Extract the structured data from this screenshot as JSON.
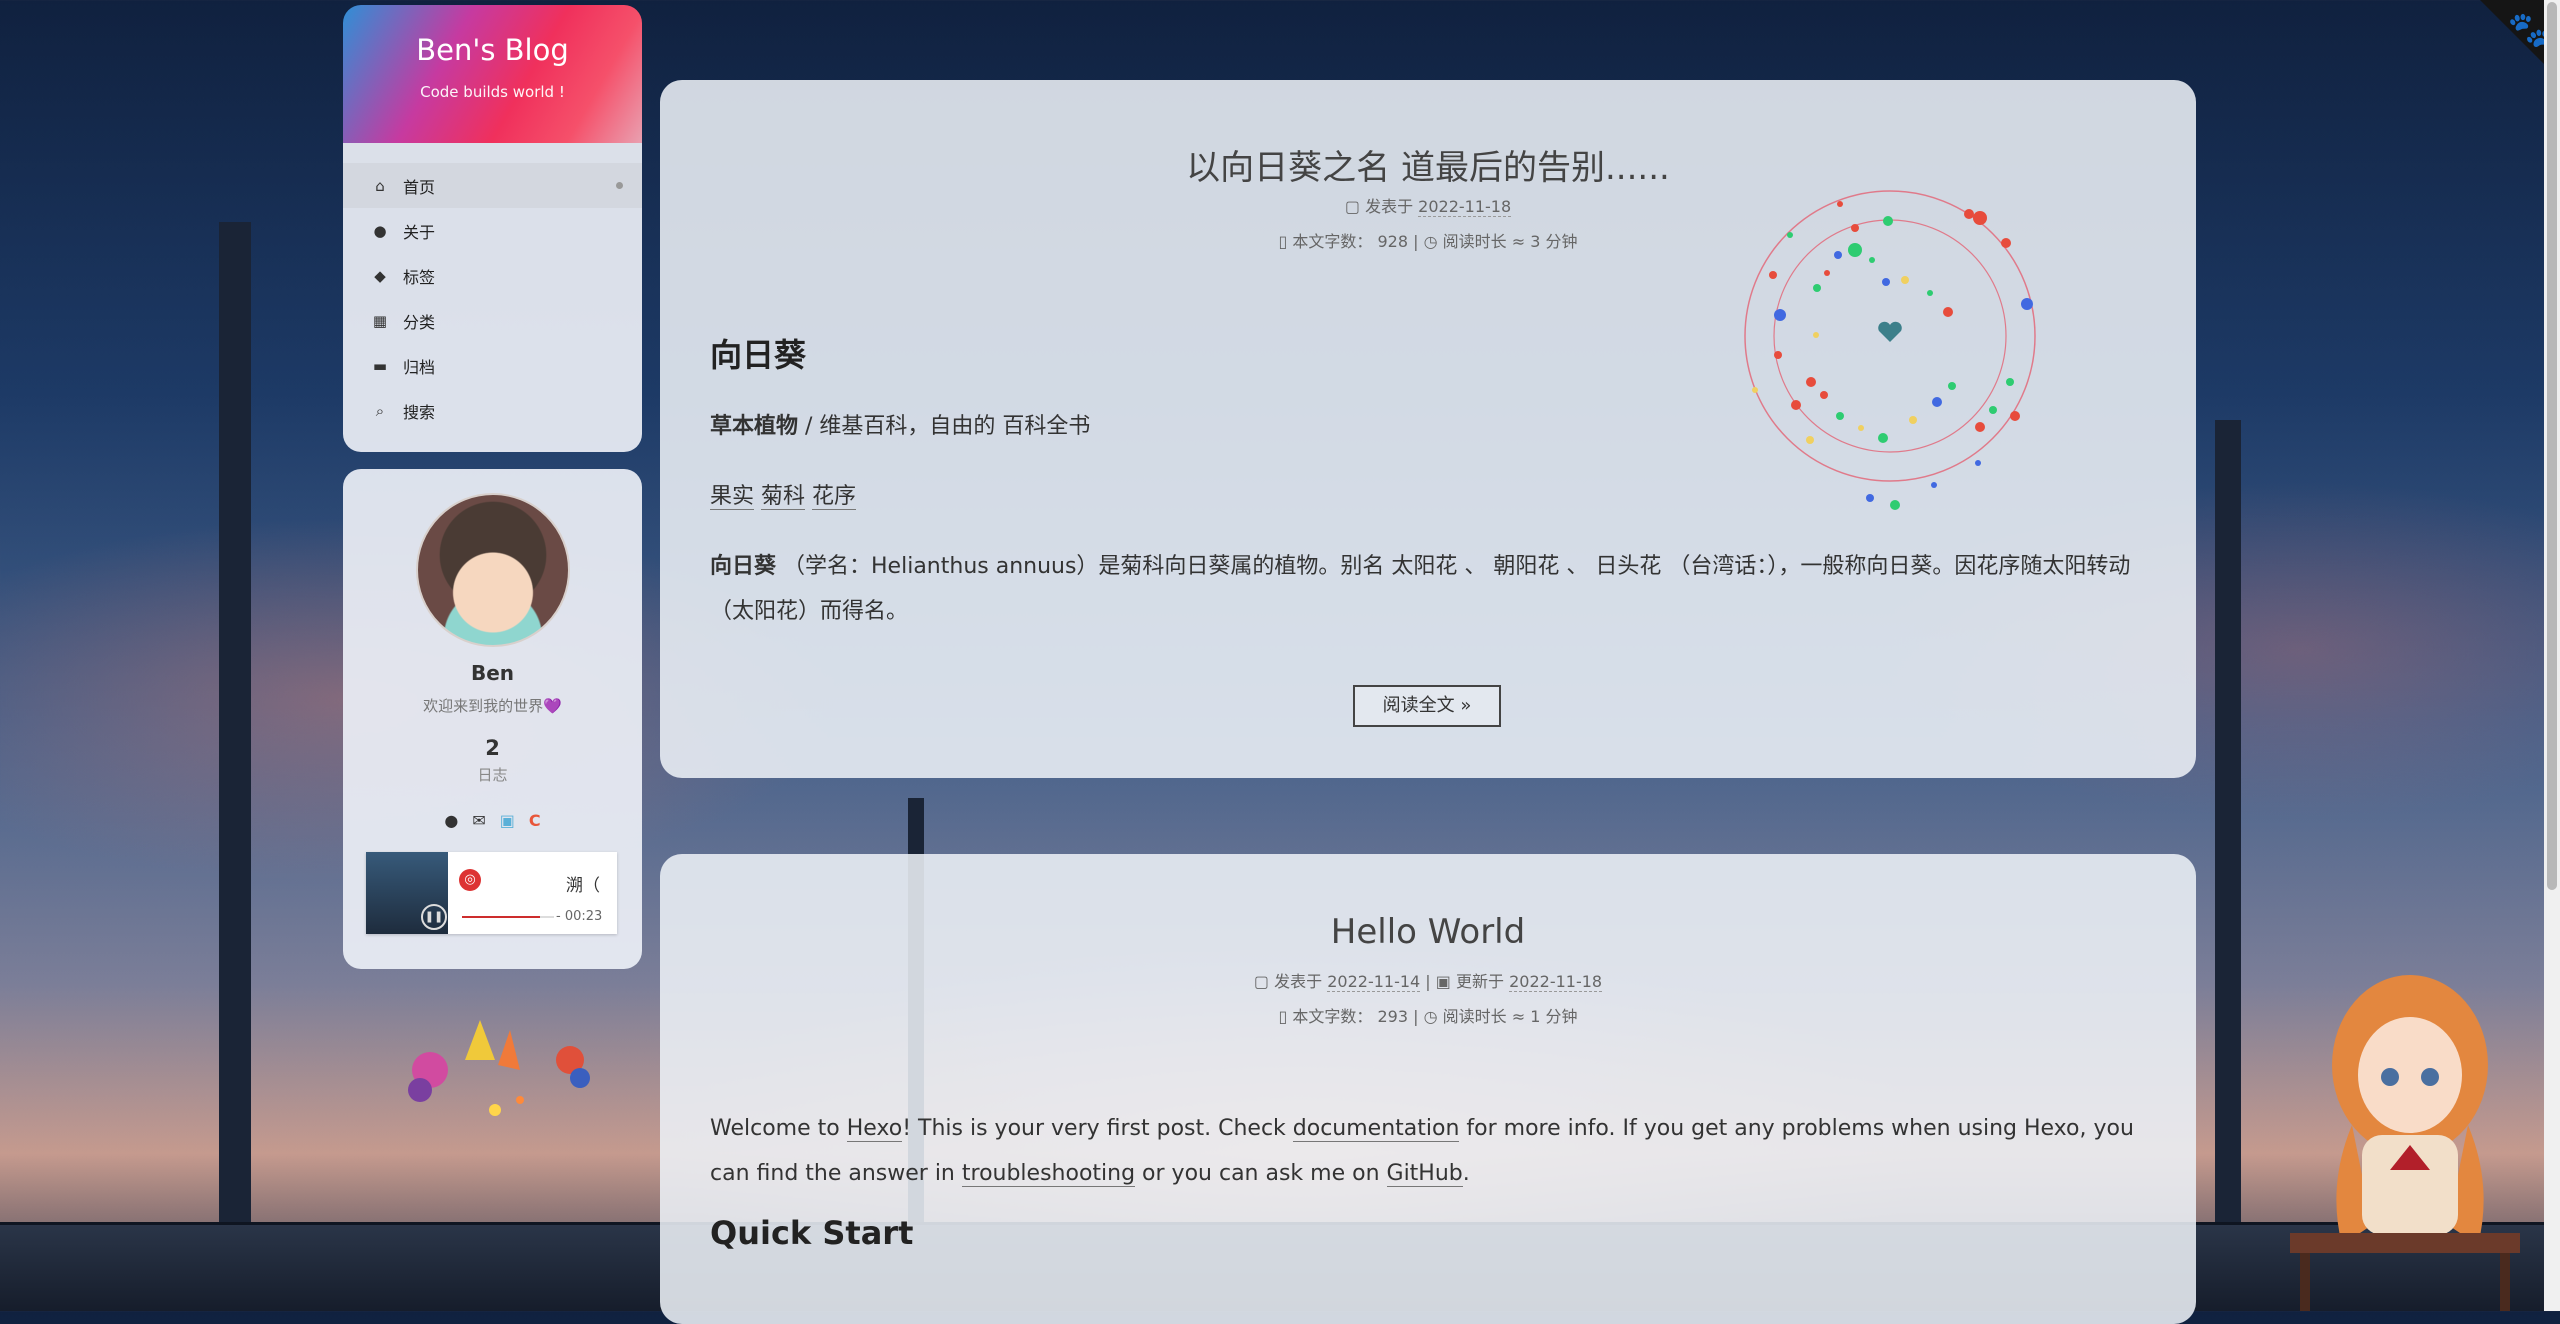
{
  "brand": {
    "title": "Ben's Blog",
    "subtitle": "Code builds world !"
  },
  "menu": [
    {
      "icon": "home-icon",
      "glyph": "⌂",
      "label": "首页"
    },
    {
      "icon": "user-icon",
      "glyph": "●",
      "label": "关于"
    },
    {
      "icon": "tags-icon",
      "glyph": "◆",
      "label": "标签"
    },
    {
      "icon": "grid-icon",
      "glyph": "▦",
      "label": "分类"
    },
    {
      "icon": "archive-icon",
      "glyph": "▬",
      "label": "归档"
    },
    {
      "icon": "search-icon",
      "glyph": "⌕",
      "label": "搜索"
    }
  ],
  "profile": {
    "name": "Ben",
    "description": "欢迎来到我的世界💜",
    "posts_count": "2",
    "posts_label": "日志"
  },
  "player": {
    "song": "溯（",
    "time": "- 00:23",
    "progress": 0.85
  },
  "post1": {
    "title": "以向日葵之名 道最后的告别......",
    "published_label": "发表于",
    "published": "2022-11-18",
    "words_label": "本文字数：",
    "words": "928",
    "readtime": "阅读时长 ≈ 3 分钟",
    "heading": "向日葵",
    "p1_bold": "草本植物",
    "p1_rest": " / 维基百科，自由的 百科全书",
    "p2_a": "果实",
    "p2_b": "菊科",
    "p2_c": "花序",
    "p3": "（学名：Helianthus annuus）是菊科向日葵属的植物。别名 太阳花 、 朝阳花 、 日头花 （台湾话：），一般称向日葵。因花序随太阳转动（太阳花）而得名。",
    "p3_lead": "向日葵",
    "read_more": "阅读全文 »"
  },
  "post2": {
    "title": "Hello World",
    "published_label": "发表于",
    "published": "2022-11-14",
    "updated_label": "更新于",
    "updated": "2022-11-18",
    "words_label": "本文字数：",
    "words": "293",
    "readtime": "阅读时长 ≈ 1 分钟",
    "p_pre": "Welcome to ",
    "p_hexo": "Hexo",
    "p_mid1": "! This is your very first post. Check ",
    "p_doc": "documentation",
    "p_mid2": " for more info. If you get any problems when using Hexo, you can find the answer in ",
    "p_trouble": "troubleshooting",
    "p_mid3": " or you can ask me on ",
    "p_github": "GitHub",
    "p_end": ".",
    "heading": "Quick Start"
  }
}
